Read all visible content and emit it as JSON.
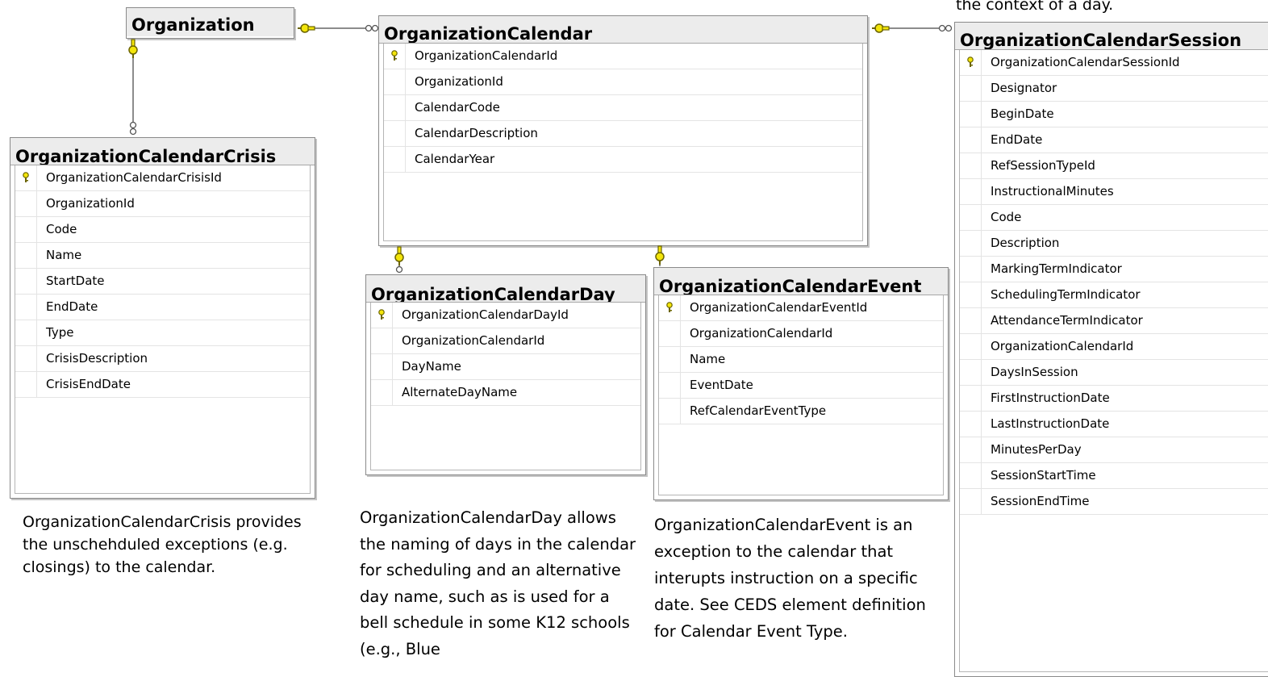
{
  "tables": {
    "organization": {
      "title": "Organization",
      "columns": []
    },
    "calendar": {
      "title": "OrganizationCalendar",
      "columns": [
        {
          "name": "OrganizationCalendarId",
          "pk": true
        },
        {
          "name": "OrganizationId",
          "pk": false
        },
        {
          "name": "CalendarCode",
          "pk": false
        },
        {
          "name": "CalendarDescription",
          "pk": false
        },
        {
          "name": "CalendarYear",
          "pk": false
        }
      ]
    },
    "session": {
      "title": "OrganizationCalendarSession",
      "columns": [
        {
          "name": "OrganizationCalendarSessionId",
          "pk": true
        },
        {
          "name": "Designator",
          "pk": false
        },
        {
          "name": "BeginDate",
          "pk": false
        },
        {
          "name": "EndDate",
          "pk": false
        },
        {
          "name": "RefSessionTypeId",
          "pk": false
        },
        {
          "name": "InstructionalMinutes",
          "pk": false
        },
        {
          "name": "Code",
          "pk": false
        },
        {
          "name": "Description",
          "pk": false
        },
        {
          "name": "MarkingTermIndicator",
          "pk": false
        },
        {
          "name": "SchedulingTermIndicator",
          "pk": false
        },
        {
          "name": "AttendanceTermIndicator",
          "pk": false
        },
        {
          "name": "OrganizationCalendarId",
          "pk": false
        },
        {
          "name": "DaysInSession",
          "pk": false
        },
        {
          "name": "FirstInstructionDate",
          "pk": false
        },
        {
          "name": "LastInstructionDate",
          "pk": false
        },
        {
          "name": "MinutesPerDay",
          "pk": false
        },
        {
          "name": "SessionStartTime",
          "pk": false
        },
        {
          "name": "SessionEndTime",
          "pk": false
        }
      ]
    },
    "crisis": {
      "title": "OrganizationCalendarCrisis",
      "columns": [
        {
          "name": "OrganizationCalendarCrisisId",
          "pk": true
        },
        {
          "name": "OrganizationId",
          "pk": false
        },
        {
          "name": "Code",
          "pk": false
        },
        {
          "name": "Name",
          "pk": false
        },
        {
          "name": "StartDate",
          "pk": false
        },
        {
          "name": "EndDate",
          "pk": false
        },
        {
          "name": "Type",
          "pk": false
        },
        {
          "name": "CrisisDescription",
          "pk": false
        },
        {
          "name": "CrisisEndDate",
          "pk": false
        }
      ]
    },
    "day": {
      "title": "OrganizationCalendarDay",
      "columns": [
        {
          "name": "OrganizationCalendarDayId",
          "pk": true
        },
        {
          "name": "OrganizationCalendarId",
          "pk": false
        },
        {
          "name": "DayName",
          "pk": false
        },
        {
          "name": "AlternateDayName",
          "pk": false
        }
      ]
    },
    "event": {
      "title": "OrganizationCalendarEvent",
      "columns": [
        {
          "name": "OrganizationCalendarEventId",
          "pk": true
        },
        {
          "name": "OrganizationCalendarId",
          "pk": false
        },
        {
          "name": "Name",
          "pk": false
        },
        {
          "name": "EventDate",
          "pk": false
        },
        {
          "name": "RefCalendarEventType",
          "pk": false
        }
      ]
    }
  },
  "notes": {
    "crisis": "OrganizationCalendarCrisis provides the unschehduled exceptions (e.g. closings) to the calendar.",
    "day": "OrganizationCalendarDay allows the naming of days in the calendar for scheduling and an alternative day name, such as is used for a bell schedule in some K12 schools (e.g., Blue",
    "event": "OrganizationCalendarEvent is an exception to the calendar that interupts instruction on a specific date. See CEDS element definition for Calendar Event Type.",
    "session": "the context of a day."
  },
  "colors": {
    "key_fill": "#f3e50a",
    "key_stroke": "#6b6400",
    "connector": "#7a7a7a"
  }
}
